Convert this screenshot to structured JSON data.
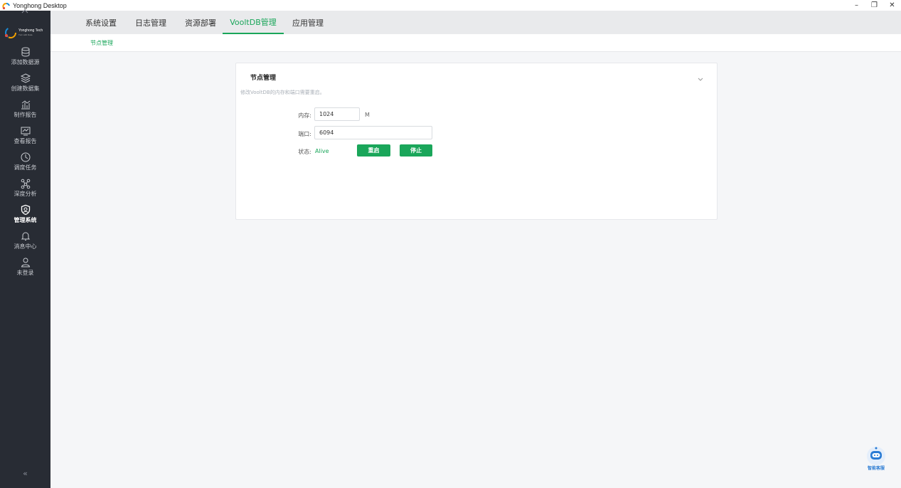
{
  "window": {
    "title": "Yonghong Desktop",
    "controls": {
      "minimize": "–",
      "restore": "❐",
      "close": "✕"
    }
  },
  "sidebar": {
    "logo_text": "Yonghong Tech",
    "logo_sub": "Turn with Data",
    "items": [
      {
        "label": "添加数据源",
        "icon": "database-icon"
      },
      {
        "label": "创建数据集",
        "icon": "layers-icon"
      },
      {
        "label": "制作报告",
        "icon": "chart-icon"
      },
      {
        "label": "查看报告",
        "icon": "monitor-icon"
      },
      {
        "label": "调度任务",
        "icon": "clock-icon"
      },
      {
        "label": "深度分析",
        "icon": "network-icon"
      },
      {
        "label": "管理系统",
        "icon": "shield-icon"
      },
      {
        "label": "消息中心",
        "icon": "bell-icon"
      },
      {
        "label": "未登录",
        "icon": "user-icon"
      }
    ],
    "collapse_label": "«",
    "active_index": 6
  },
  "tabs": [
    {
      "label": "系统设置"
    },
    {
      "label": "日志管理"
    },
    {
      "label": "资源部署"
    },
    {
      "label": "VooltDB管理"
    },
    {
      "label": "应用管理"
    }
  ],
  "active_tab": 3,
  "subtab": {
    "label": "节点管理"
  },
  "card": {
    "title": "节点管理",
    "description": "修改VooltDB的内存和端口需要重启。",
    "memory": {
      "label": "内存:",
      "value": "1024",
      "unit": "M"
    },
    "port": {
      "label": "端口:",
      "value": "6094"
    },
    "status": {
      "label": "状态:",
      "value": "Alive"
    },
    "restart_label": "重启",
    "stop_label": "停止"
  },
  "assistant": {
    "label": "智能客服"
  },
  "colors": {
    "accent": "#1aa65a",
    "sidebar": "#282c34"
  }
}
